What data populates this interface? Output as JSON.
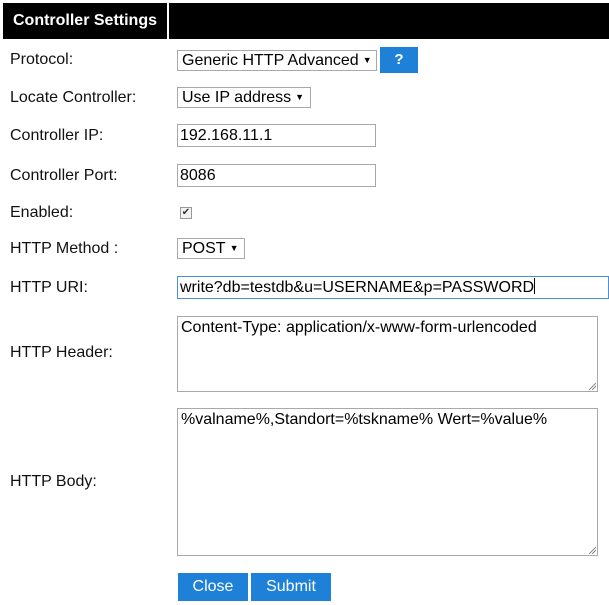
{
  "header": {
    "title": "Controller Settings"
  },
  "fields": {
    "protocol": {
      "label": "Protocol:",
      "value": "Generic HTTP Advanced",
      "help": "?"
    },
    "locate": {
      "label": "Locate Controller:",
      "value": "Use IP address"
    },
    "ip": {
      "label": "Controller IP:",
      "value": "192.168.11.1"
    },
    "port": {
      "label": "Controller Port:",
      "value": "8086"
    },
    "enabled": {
      "label": "Enabled:",
      "checked": true,
      "mark": "✔"
    },
    "method": {
      "label": "HTTP Method :",
      "value": "POST"
    },
    "uri": {
      "label": "HTTP URI:",
      "value": "write?db=testdb&u=USERNAME&p=PASSWORD"
    },
    "header": {
      "label": "HTTP Header:",
      "value": "Content-Type: application/x-www-form-urlencoded"
    },
    "body": {
      "label": "HTTP Body:",
      "value": "%valname%,Standort=%tskname% Wert=%value%"
    }
  },
  "buttons": {
    "close": "Close",
    "submit": "Submit"
  },
  "icons": {
    "dropdown": "▼"
  },
  "colors": {
    "accent": "#1e80d6",
    "header_bg": "#000000"
  }
}
